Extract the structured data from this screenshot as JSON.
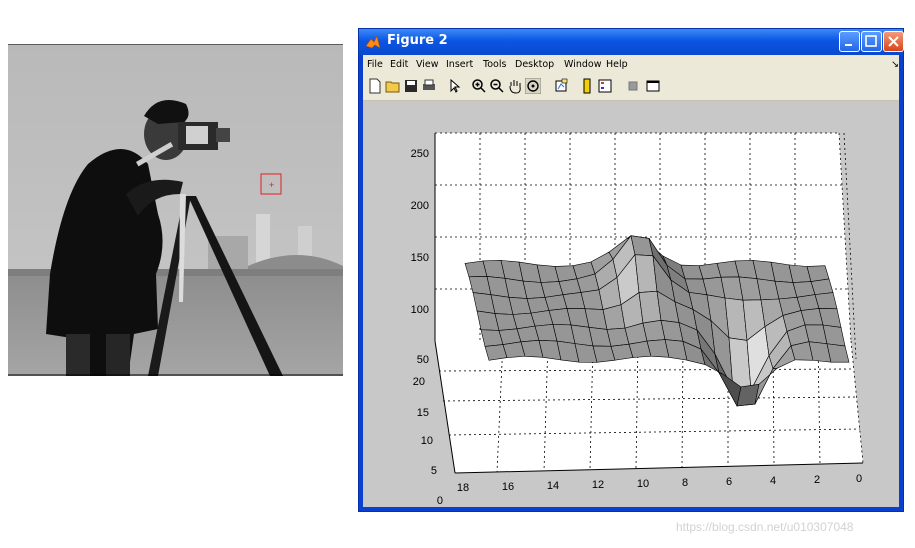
{
  "window": {
    "title": "Figure 2",
    "menu": [
      "File",
      "Edit",
      "View",
      "Insert",
      "Tools",
      "Desktop",
      "Window",
      "Help"
    ],
    "toolbar": [
      "new-file-icon",
      "open-folder-icon",
      "save-icon",
      "print-icon",
      "pointer-icon",
      "zoom-in-icon",
      "zoom-out-icon",
      "pan-hand-icon",
      "rotate-3d-icon",
      "data-cursor-icon",
      "colorbar-icon",
      "legend-icon",
      "hide-plot-tools-icon",
      "show-plot-tools-icon"
    ],
    "colors": {
      "titlebar": "#0b56e3",
      "menu_bg": "#ece9d8",
      "plot_bg": "#c8c8c8",
      "surface": "#9a9a9a"
    }
  },
  "photo": {
    "description_marker_color": "#e02020"
  },
  "chart_data": {
    "type": "surface",
    "z_ticks": [
      "50",
      "100",
      "150",
      "200",
      "250"
    ],
    "y_ticks": [
      "0",
      "5",
      "10",
      "15",
      "20"
    ],
    "x_ticks": [
      "18",
      "16",
      "14",
      "12",
      "10",
      "8",
      "6",
      "4",
      "2",
      "0"
    ],
    "zlim": [
      50,
      250
    ],
    "xlim": [
      0,
      20
    ],
    "ylim": [
      0,
      20
    ],
    "grid": true,
    "baseline_intensity": 115,
    "peak_intensity": 165,
    "dip_intensity": 45
  },
  "watermark": "https://blog.csdn.net/u010307048"
}
